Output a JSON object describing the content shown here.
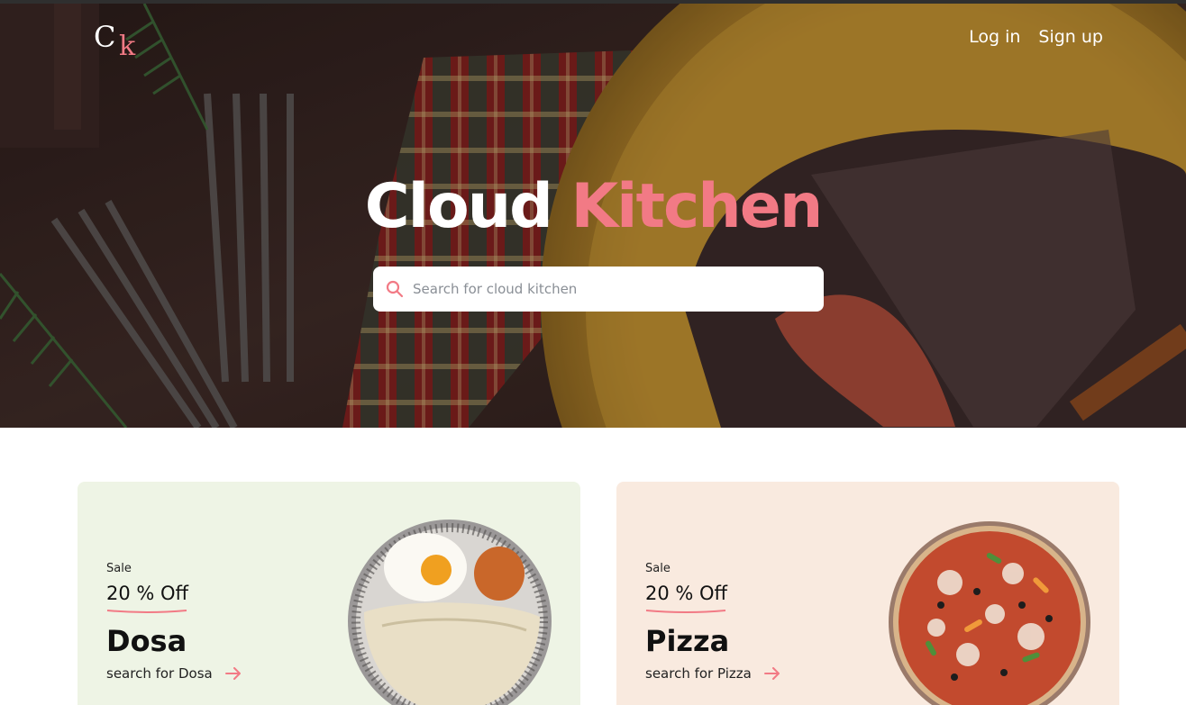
{
  "brand": {
    "logo_c": "C",
    "logo_k": "k"
  },
  "nav": {
    "login": "Log in",
    "signup": "Sign up"
  },
  "hero": {
    "title_part1": "Cloud",
    "title_part2": "Kitchen",
    "search_placeholder": "Search for cloud kitchen"
  },
  "offers": [
    {
      "sale": "Sale",
      "discount": "20 % Off",
      "name": "Dosa",
      "link": "search for Dosa",
      "bg": "#eef4e5"
    },
    {
      "sale": "Sale",
      "discount": "20 % Off",
      "name": "Pizza",
      "link": "search for Pizza",
      "bg": "#f9eadf"
    }
  ],
  "colors": {
    "accent": "#f27a85",
    "white": "#ffffff"
  },
  "icons": {
    "search": "search-icon",
    "arrow": "arrow-right-icon"
  }
}
